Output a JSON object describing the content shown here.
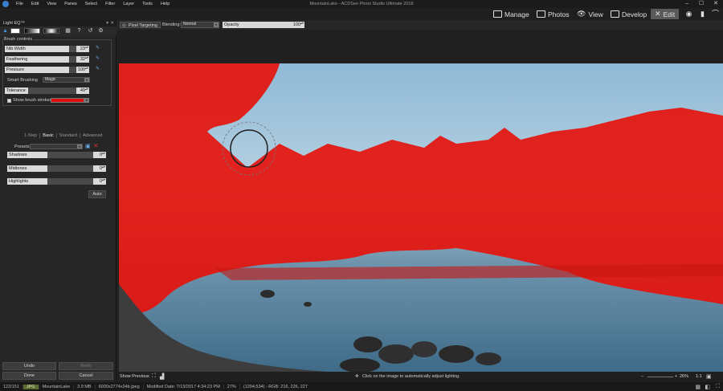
{
  "menubar": {
    "items": [
      "File",
      "Edit",
      "View",
      "Panes",
      "Select",
      "Filter",
      "Layer",
      "Tools",
      "Help"
    ],
    "title": "MountainLake - ACDSee Photo Studio Ultimate 2018"
  },
  "modes": {
    "manage": "Manage",
    "photos": "Photos",
    "view": "View",
    "develop": "Develop",
    "edit": "Edit"
  },
  "panel": {
    "title": "Light EQ™",
    "brush_group_label": "Brush controls",
    "nib_width": {
      "label": "Nib Width",
      "value": "23",
      "fraction": 0.78
    },
    "feathering": {
      "label": "Feathering",
      "value": "32",
      "fraction": 0.78
    },
    "pressure": {
      "label": "Pressure",
      "value": "100",
      "fraction": 0.78
    },
    "smart_brushing_label": "Smart Brushing",
    "smart_brushing_value": "Magic",
    "tolerance": {
      "label": "Tolerance",
      "value": "49",
      "fraction": 0.28
    },
    "show_strokes_label": "Show brush strokes",
    "stroke_color": "#e01010",
    "tabs": [
      "1-Step",
      "Basic",
      "Standard",
      "Advanced"
    ],
    "active_tab": "Basic",
    "presets_label": "Presets",
    "presets_value": "",
    "shadows": {
      "label": "Shadows",
      "value": "0",
      "fraction": 0.47
    },
    "midtones": {
      "label": "Midtones",
      "value": "0",
      "fraction": 0.47
    },
    "highlights": {
      "label": "Highlights",
      "value": "0",
      "fraction": 0.47
    },
    "auto_label": "Auto",
    "undo_label": "Undo",
    "redo_label": "Redo",
    "done_label": "Done",
    "cancel_label": "Cancel"
  },
  "toolbar": {
    "pixel_targeting": "Pixel Targeting",
    "blending_label": "Blending:",
    "blending_value": "Normal",
    "opacity_label": "Opacity",
    "opacity_value": "100"
  },
  "hint": {
    "show_previous": "Show Previous",
    "message": "Click on the image to automatically adjust lighting.",
    "zoom": "26%",
    "ratio": "1:1"
  },
  "status": {
    "count": "122/151",
    "format": "JPG",
    "filename": "MountainLake",
    "size": "3.9 MB",
    "dims": "6000x2774x24b jpeg",
    "modified": "Modified Date: 7/13/2017 4:34:23 PM",
    "zoom": "27%",
    "pixel": "(1294,534) - RGB: 216, 226, 227"
  }
}
